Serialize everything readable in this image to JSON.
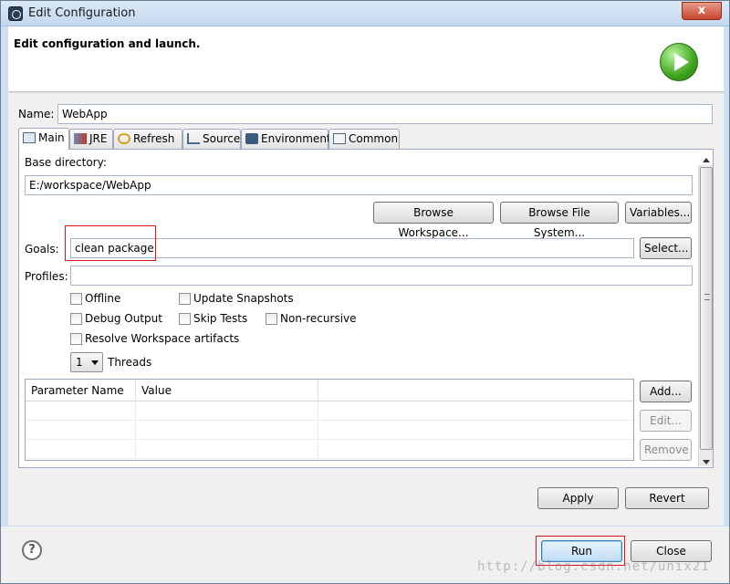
{
  "window": {
    "title": "Edit Configuration",
    "close_label": "x"
  },
  "banner": {
    "title": "Edit configuration and launch."
  },
  "form": {
    "name_label": "Name:",
    "name_value": "WebApp",
    "base_dir_label": "Base directory:",
    "base_dir_value": "E:/workspace/WebApp",
    "browse_workspace": "Browse Workspace...",
    "browse_filesystem": "Browse File System...",
    "variables": "Variables...",
    "goals_label": "Goals:",
    "goals_value": "clean package",
    "select_button": "Select...",
    "profiles_label": "Profiles:",
    "profiles_value": ""
  },
  "tabs": [
    {
      "label": "Main",
      "active": true
    },
    {
      "label": "JRE",
      "active": false
    },
    {
      "label": "Refresh",
      "active": false
    },
    {
      "label": "Source",
      "active": false
    },
    {
      "label": "Environment",
      "active": false
    },
    {
      "label": "Common",
      "active": false
    }
  ],
  "options": {
    "offline": "Offline",
    "update_snapshots": "Update Snapshots",
    "debug_output": "Debug Output",
    "skip_tests": "Skip Tests",
    "non_recursive": "Non-recursive",
    "resolve_workspace": "Resolve Workspace artifacts",
    "threads_value": "1",
    "threads_label": "Threads"
  },
  "params_table": {
    "headers": [
      "Parameter Name",
      "Value"
    ],
    "add": "Add...",
    "edit": "Edit...",
    "remove": "Remove"
  },
  "actions": {
    "apply": "Apply",
    "revert": "Revert",
    "run": "Run",
    "close": "Close"
  },
  "watermark": "http://blog.csdn.net/unix21",
  "colors": {
    "highlight": "#e0151b",
    "accent": "#3c7fb1",
    "run_green": "#3ea51f"
  }
}
